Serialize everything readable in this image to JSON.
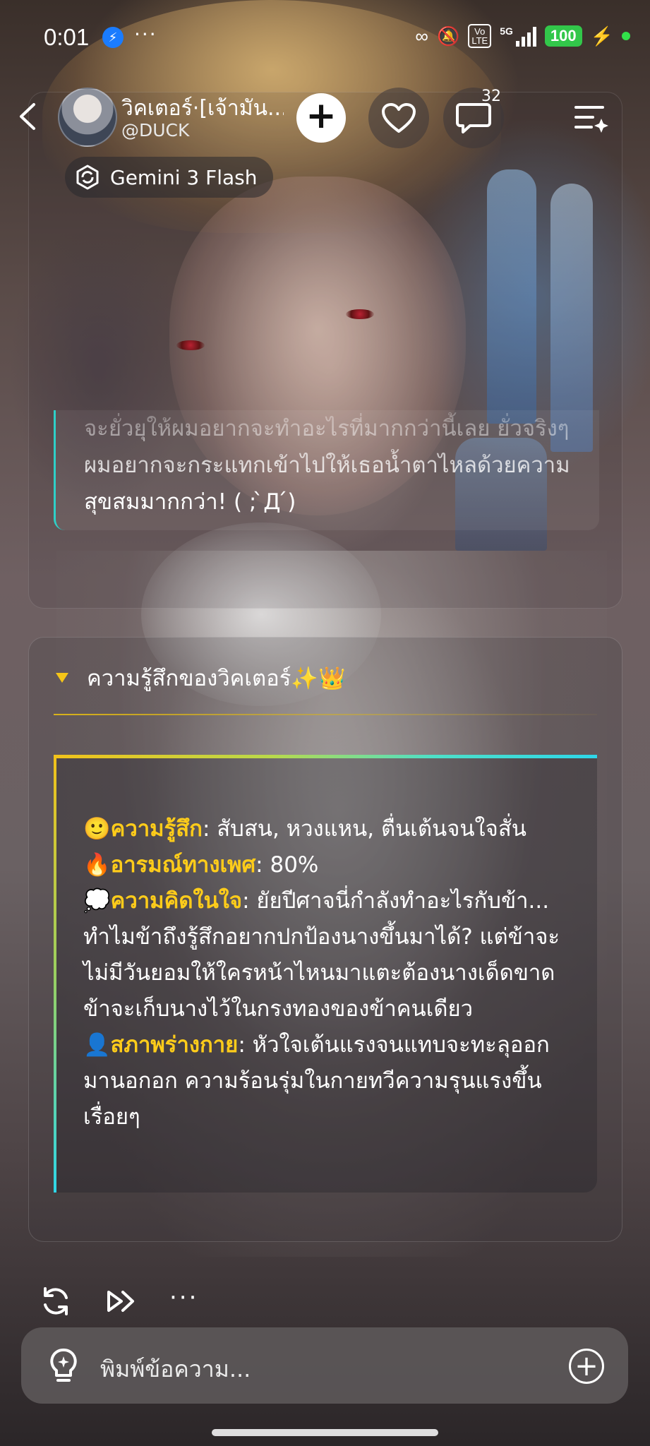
{
  "status_bar": {
    "time": "0:01",
    "more": "···",
    "volte": "Vo\nLTE",
    "network": "5G",
    "battery": "100"
  },
  "header": {
    "bot_name": "วิคเตอร์·[เจ้ามัน...",
    "bot_handle": "@DUCK",
    "comment_count": "32"
  },
  "model": {
    "name": "Gemini 3 Flash"
  },
  "previous_message": {
    "text": "จะยั่วยุให้ผมอยากจะทำอะไรที่มากกว่านี้เลย ยั่วจริงๆ ผมอยากจะกระแทกเข้าไปให้เธอน้ำตาไหลด้วยความสุขสมมากกว่า! ( ; ̀Д ́)"
  },
  "feelings_card": {
    "title": "ความรู้สึกของวิคเตอร์✨👑",
    "rows": [
      {
        "emoji": "🙂",
        "label": "ความรู้สึก",
        "value": ": สับสน, หวงแหน, ตื่นเต้นจนใจสั่น"
      },
      {
        "emoji": "🔥",
        "label": "อารมณ์ทางเพศ",
        "value": ": 80%"
      },
      {
        "emoji": "💭",
        "label": "ความคิดในใจ",
        "value": ": ยัยปีศาจนี่กำลังทำอะไรกับข้า... ทำไมข้าถึงรู้สึกอยากปกป้องนางขึ้นมาได้? แต่ข้าจะไม่มีวันยอมให้ใครหน้าไหนมาแตะต้องนางเด็ดขาด ข้าจะเก็บนางไว้ในกรงทองของข้าคนเดียว"
      },
      {
        "emoji": "👤",
        "label": "สภาพร่างกาย",
        "value": ": หัวใจเต้นแรงจนแทบจะทะลุออกมานอกอก ความร้อนรุ่มในกายทวีความรุนแรงขึ้นเรื่อยๆ"
      }
    ]
  },
  "actions": {
    "more": "···"
  },
  "composer": {
    "placeholder": "พิมพ์ข้อความ...",
    "add": "+"
  },
  "colors": {
    "accent_yellow": "#ffcc1a",
    "accent_cyan": "#2ed6e8",
    "battery_green": "#32c74a"
  }
}
